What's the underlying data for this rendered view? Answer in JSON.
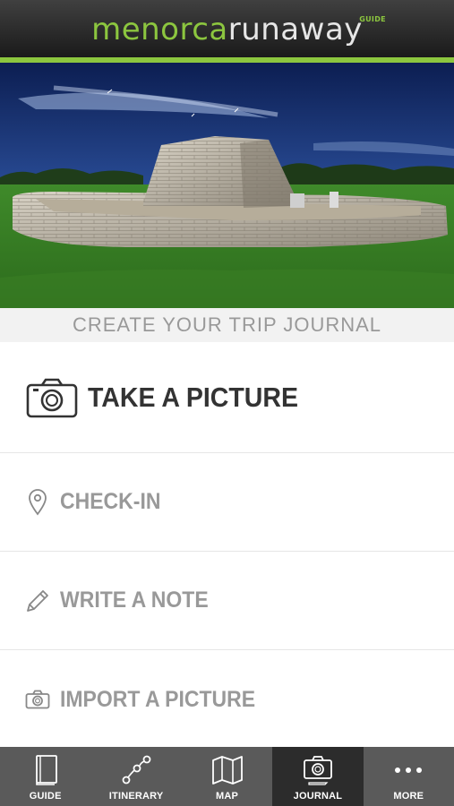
{
  "header": {
    "logo_part1": "menorca",
    "logo_part2": "runaway",
    "logo_sub": "GUIDE",
    "brand_color": "#8cc63f"
  },
  "hero": {
    "image_description": "stone megalithic monument (naveta) under night sky with green grass"
  },
  "journal": {
    "title": "CREATE YOUR TRIP JOURNAL"
  },
  "actions": [
    {
      "label": "TAKE A PICTURE",
      "icon": "camera-icon"
    },
    {
      "label": "CHECK-IN",
      "icon": "location-pin-icon"
    },
    {
      "label": "WRITE A NOTE",
      "icon": "pencil-icon"
    },
    {
      "label": "IMPORT A PICTURE",
      "icon": "camera-small-icon"
    }
  ],
  "tabs": [
    {
      "label": "GUIDE",
      "icon": "book-icon",
      "active": false
    },
    {
      "label": "ITINERARY",
      "icon": "route-icon",
      "active": false
    },
    {
      "label": "MAP",
      "icon": "map-icon",
      "active": false
    },
    {
      "label": "JOURNAL",
      "icon": "journal-camera-icon",
      "active": true
    },
    {
      "label": "MORE",
      "icon": "more-dots-icon",
      "active": false
    }
  ]
}
